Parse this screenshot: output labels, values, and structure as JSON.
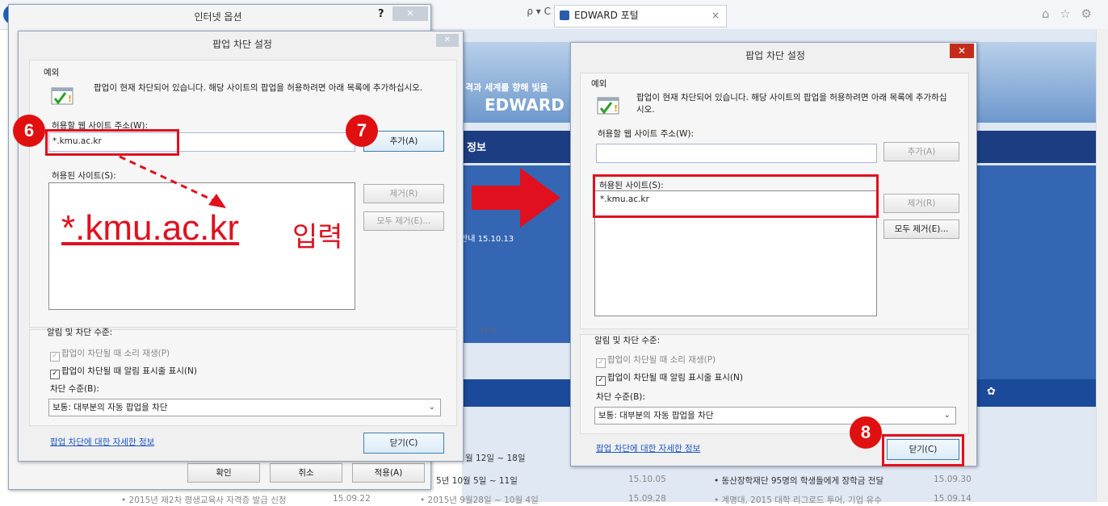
{
  "browser": {
    "address_controls": "ρ ▾ C",
    "tab_label": "EDWARD 포털",
    "tab_close": "×",
    "toolbar_icons": "⌂ ☆ ⚙"
  },
  "site": {
    "slogan": "격과 세계를 향해 빛을",
    "brand": "EDWARD",
    "nav_item": "정보",
    "notice": "안내 15.10.13",
    "year": "1978",
    "news": [
      {
        "title": "월 12일 ~ 18일",
        "date": ""
      },
      {
        "title": "5년 10월 5일 ~ 11일",
        "date": "15.10.05"
      },
      {
        "title": "• 동산장학재단 95명의 학생들에게 장학금 전달",
        "date": "15.09.30"
      },
      {
        "title": "• 2015년 제2차 평생교육사 자격증 발급 신청",
        "date": "15.09.22"
      },
      {
        "title": "• 2015년 9월28일 ~ 10월 4일",
        "date": "15.09.28"
      },
      {
        "title": "• 계명대, 2015 대학 리그로드 투어, 기업 유수",
        "date": "15.09.14"
      }
    ]
  },
  "internet_options": {
    "title": "인터넷 옵션",
    "help": "?",
    "buttons": {
      "ok": "확인",
      "cancel": "취소",
      "apply": "적용(A)"
    }
  },
  "left_dialog": {
    "title": "팝업 차단 설정",
    "exceptions_label": "예외",
    "info_text": "팝업이 현재 차단되어 있습니다. 해당 사이트의 팝업을 허용하려면 아래 목록에 추가하십시오.",
    "address_label": "허용할 웹 사이트 주소(W):",
    "address_value": "*.kmu.ac.kr",
    "add_button": "추가(A)",
    "allowed_label": "허용된 사이트(S):",
    "remove_button": "제거(R)",
    "remove_all_button": "모두 제거(E)...",
    "notify_label": "알림 및 차단 수준:",
    "sound_option": "팝업이 차단될 때 소리 재생(P)",
    "notify_option": "팝업이 차단될 때 알림 표시줄 표시(N)",
    "level_label": "차단 수준(B):",
    "level_value": "보통: 대부분의 자동 팝업을 차단",
    "info_link": "팝업 차단에 대한 자세한 정보",
    "close_button": "닫기(C)"
  },
  "right_dialog": {
    "title": "팝업 차단 설정",
    "close_x": "✕",
    "exceptions_label": "예외",
    "info_text": "팝업이 현재 차단되어 있습니다. 해당 사이트의 팝업을 허용하려면 아래 목록에 추가하십시오.",
    "address_label": "허용할 웹 사이트 주소(W):",
    "address_value": "",
    "add_button": "추가(A)",
    "allowed_label": "허용된 사이트(S):",
    "allowed_sites": [
      "*.kmu.ac.kr"
    ],
    "remove_button": "제거(R)",
    "remove_all_button": "모두 제거(E)...",
    "notify_label": "알림 및 차단 수준:",
    "sound_option": "팝업이 차단될 때 소리 재생(P)",
    "notify_option": "팝업이 차단될 때 알림 표시줄 표시(N)",
    "level_label": "차단 수준(B):",
    "level_value": "보통: 대부분의 자동 팝업을 차단",
    "info_link": "팝업 차단에 대한 자세한 정보",
    "close_button": "닫기(C)"
  },
  "annotations": {
    "step6": "6",
    "step7": "7",
    "step8": "8",
    "big_text": "*.kmu.ac.kr",
    "big_text_suffix": "입력",
    "accent_color": "#e0101f"
  }
}
